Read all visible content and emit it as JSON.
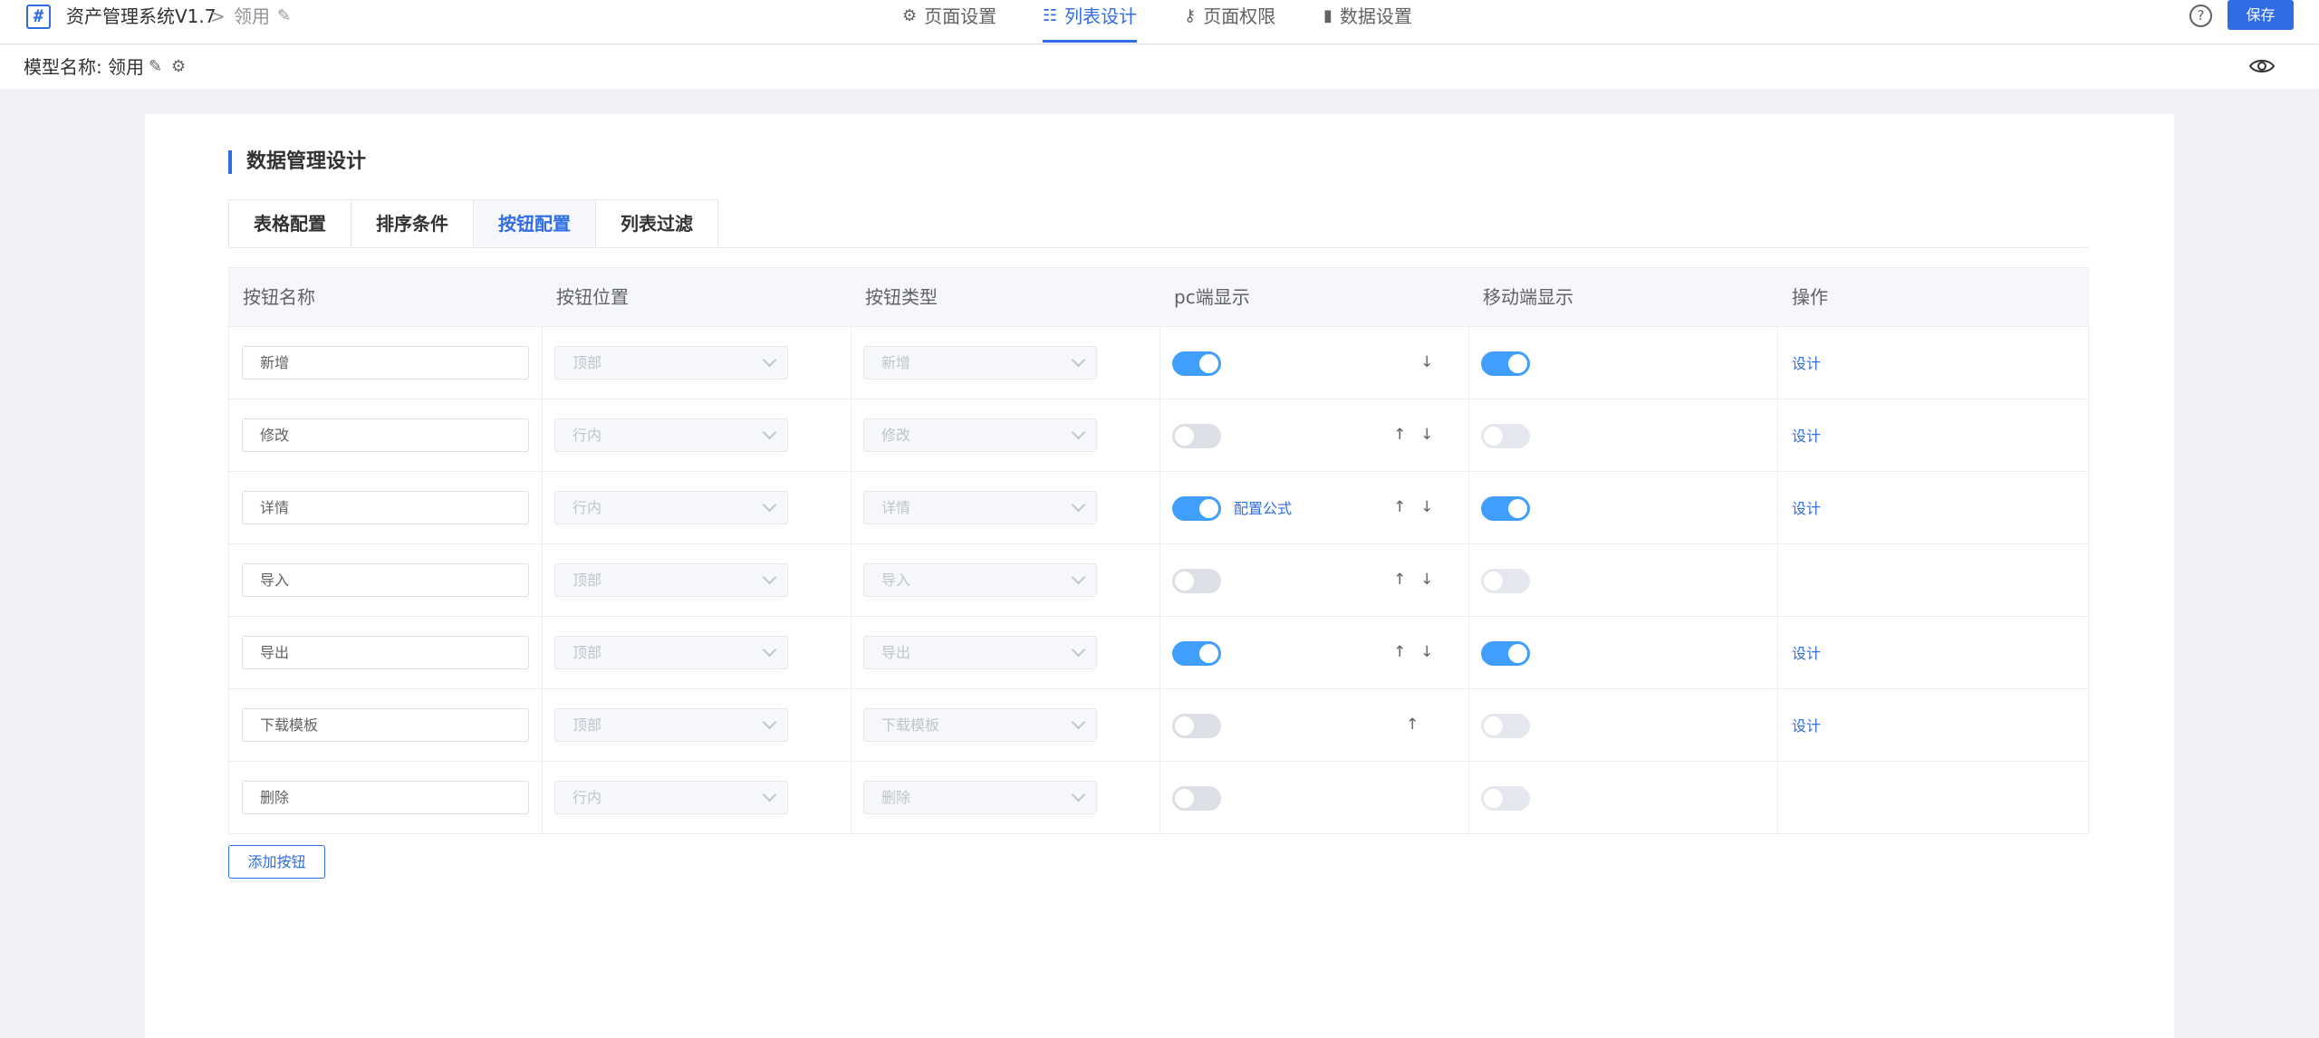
{
  "header": {
    "app_name": "资产管理系统V1.7",
    "separator": ">",
    "page_name": "领用",
    "edit_glyph": "✎",
    "tabs": [
      {
        "label": "页面设置",
        "icon": "settings-icon",
        "glyph": "⚙"
      },
      {
        "label": "列表设计",
        "icon": "list-icon",
        "glyph": "☷"
      },
      {
        "label": "页面权限",
        "icon": "key-icon",
        "glyph": "⚷"
      },
      {
        "label": "数据设置",
        "icon": "bar-chart-icon",
        "glyph": "▮"
      }
    ],
    "active_tab": "列表设计",
    "help_glyph": "?",
    "save_label": "保存"
  },
  "model": {
    "label": "模型名称:",
    "value": "领用",
    "edit_glyph": "✎",
    "gear_glyph": "⚙"
  },
  "section": {
    "title": "数据管理设计",
    "subtabs": [
      "表格配置",
      "排序条件",
      "按钮配置",
      "列表过滤"
    ],
    "active_subtab": "按钮配置"
  },
  "table": {
    "headers": [
      "按钮名称",
      "按钮位置",
      "按钮类型",
      "pc端显示",
      "移动端显示",
      "操作"
    ],
    "rows": [
      {
        "name": "新增",
        "position": "顶部",
        "type": "新增",
        "pc": true,
        "formula": "",
        "up": false,
        "down": true,
        "mobile": true,
        "action": "设计"
      },
      {
        "name": "修改",
        "position": "行内",
        "type": "修改",
        "pc": false,
        "formula": "",
        "up": true,
        "down": true,
        "mobile": false,
        "action": "设计"
      },
      {
        "name": "详情",
        "position": "行内",
        "type": "详情",
        "pc": true,
        "formula": "配置公式",
        "up": true,
        "down": true,
        "mobile": true,
        "action": "设计"
      },
      {
        "name": "导入",
        "position": "顶部",
        "type": "导入",
        "pc": false,
        "formula": "",
        "up": true,
        "down": true,
        "mobile": false,
        "action": ""
      },
      {
        "name": "导出",
        "position": "顶部",
        "type": "导出",
        "pc": true,
        "formula": "",
        "up": true,
        "down": true,
        "mobile": true,
        "action": "设计"
      },
      {
        "name": "下载模板",
        "position": "顶部",
        "type": "下载模板",
        "pc": false,
        "formula": "",
        "up": true,
        "down": false,
        "mobile": false,
        "action": "设计"
      },
      {
        "name": "删除",
        "position": "行内",
        "type": "删除",
        "pc": false,
        "formula": "",
        "up": false,
        "down": false,
        "mobile": false,
        "action": ""
      }
    ],
    "arrow_up": "↑",
    "arrow_down": "↓"
  },
  "add_button_label": "添加按钮",
  "colors": {
    "accent": "#2f6ce5",
    "switch_on": "#409eff"
  }
}
